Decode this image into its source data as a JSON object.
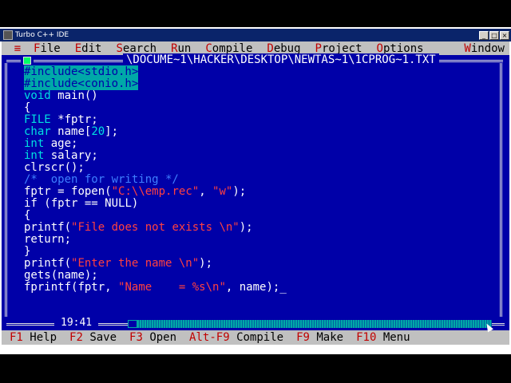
{
  "window": {
    "title": "Turbo C++ IDE",
    "controls": [
      "_",
      "□",
      "×"
    ]
  },
  "menu": {
    "system": "≡",
    "items": [
      {
        "hk": "F",
        "rest": "ile"
      },
      {
        "hk": "E",
        "rest": "dit"
      },
      {
        "hk": "S",
        "rest": "earch"
      },
      {
        "hk": "R",
        "rest": "un"
      },
      {
        "hk": "C",
        "rest": "ompile"
      },
      {
        "hk": "D",
        "rest": "ebug"
      },
      {
        "hk": "P",
        "rest": "roject"
      },
      {
        "hk": "O",
        "rest": "ptions"
      },
      {
        "hk": "W",
        "rest": "indow"
      }
    ]
  },
  "editor": {
    "filename": "\\DOCUME~1\\HACKER\\DESKTOP\\NEWTAS~1\\1CPROG~1.TXT",
    "cursor_pos": "19:41",
    "lines": [
      "#include<stdio.h>",
      "#include<conio.h>",
      "void main()",
      "{",
      "FILE *fptr;",
      "char name[20];",
      "int age;",
      "int salary;",
      "clrscr();",
      "/*  open for writing */",
      "fptr = fopen(\"C:\\\\emp.rec\", \"w\");",
      "if (fptr == NULL)",
      "{",
      "printf(\"File does not exists \\n\");",
      "return;",
      "}",
      "printf(\"Enter the name \\n\");",
      "gets(name);",
      "fprintf(fptr, \"Name    = %s\\n\", name);"
    ]
  },
  "status": [
    {
      "key": "F1",
      "label": "Help"
    },
    {
      "key": "F2",
      "label": "Save"
    },
    {
      "key": "F3",
      "label": "Open"
    },
    {
      "key": "Alt-F9",
      "label": "Compile"
    },
    {
      "key": "F9",
      "label": "Make"
    },
    {
      "key": "F10",
      "label": "Menu"
    }
  ],
  "colors": {
    "editor_bg": "#0000a8",
    "menu_bg": "#c0c0c0",
    "hotkey": "#c00000",
    "string": "#ff4040",
    "comment": "#3f7fff"
  }
}
